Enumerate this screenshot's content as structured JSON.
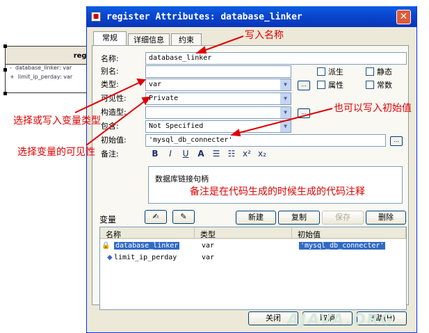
{
  "background_class": {
    "name": "regi",
    "attributes": [
      {
        "visibility": "-",
        "text": "database_linker: var"
      },
      {
        "visibility": "+",
        "text": "limit_ip_perday: var"
      }
    ]
  },
  "window": {
    "title": "register Attributes: database_linker",
    "close": "✕"
  },
  "tabs": [
    {
      "label": "常规",
      "active": true
    },
    {
      "label": "详细信息"
    },
    {
      "label": "约束"
    }
  ],
  "form": {
    "name_label": "名称:",
    "name_value": "database_linker",
    "alias_label": "别名:",
    "alias_value": "",
    "type_label": "类型:",
    "type_value": "var",
    "visibility_label": "可见性:",
    "visibility_value": "Private",
    "stereotype_label": "构造型:",
    "stereotype_value": "",
    "containment_label": "包含:",
    "containment_value": "Not Specified",
    "initial_label": "初始值:",
    "initial_value": "'mysql_db_connecter'",
    "note_label": "备注:",
    "note_text": "数据库链接句柄"
  },
  "checkboxes": [
    {
      "label": "派生",
      "checked": false
    },
    {
      "label": "静态",
      "checked": false
    },
    {
      "label": "属性",
      "checked": false
    },
    {
      "label": "常数",
      "checked": false
    }
  ],
  "ellipsis": "...",
  "note_toolbar": [
    "B",
    "I",
    "U",
    "A",
    "☰",
    "☷",
    "x²",
    "x₂"
  ],
  "variables_label": "变量",
  "var_buttons": {
    "new": "新建",
    "copy": "复制",
    "save": "保存",
    "delete": "删除"
  },
  "grid": {
    "columns": [
      "名称",
      "类型",
      "初始值"
    ],
    "rows": [
      {
        "name": "database_linker",
        "type": "var",
        "initial": "'mysql_db_connecter'",
        "selected": true
      },
      {
        "name": "limit_ip_perday",
        "type": "var",
        "initial": "",
        "selected": false
      }
    ]
  },
  "footer_buttons": {
    "close": "关闭",
    "cancel": "取消",
    "help": "帮助(H)"
  },
  "annotations": {
    "write_name": "写入名称",
    "initial_hint": "也可以写入初始值",
    "type_hint": "选择或写入变量类型",
    "visibility_hint": "选择变量的可见性",
    "note_hint": "备注是在代码生成的时候生成的代码注释"
  },
  "watermark": "AJAVA.ORG",
  "colors": {
    "annotation": "#e00000",
    "selection": "#316ac5",
    "titlebar": "#0a48d1"
  }
}
